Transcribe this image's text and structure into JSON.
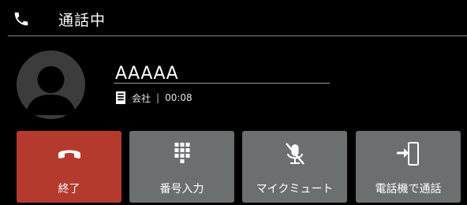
{
  "header": {
    "title": "通話中"
  },
  "caller": {
    "name": "AAAAA",
    "category": "会社",
    "separator": "|",
    "duration": "00:08"
  },
  "buttons": [
    {
      "label": "終了",
      "icon": "hang-up-icon"
    },
    {
      "label": "番号入力",
      "icon": "keypad-icon"
    },
    {
      "label": "マイクミュート",
      "icon": "mic-mute-icon"
    },
    {
      "label": "電話機で通話",
      "icon": "transfer-to-phone-icon"
    }
  ],
  "colors": {
    "background": "#000000",
    "end_button": "#b43a2e",
    "button": "#6b6f70"
  }
}
